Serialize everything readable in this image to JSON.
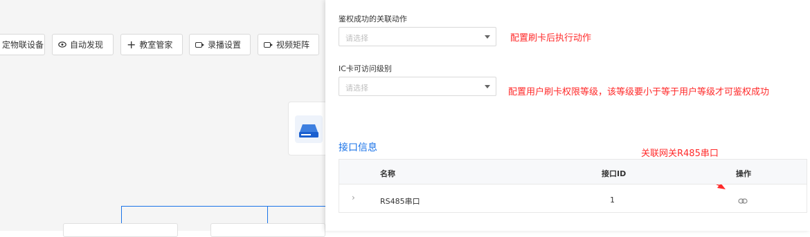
{
  "toolbar": {
    "items": [
      {
        "label": "定物联设备",
        "icon": "none"
      },
      {
        "label": "自动发现",
        "icon": "eye-icon"
      },
      {
        "label": "教室管家",
        "icon": "plus-icon"
      },
      {
        "label": "录播设置",
        "icon": "video-icon"
      },
      {
        "label": "视频矩阵",
        "icon": "video-icon"
      }
    ]
  },
  "drawer": {
    "field1": {
      "label": "鉴权成功的关联动作",
      "placeholder": "请选择"
    },
    "field2": {
      "label": "IC卡可访问级别",
      "placeholder": "请选择"
    },
    "annotations": {
      "note1": "配置刷卡后执行动作",
      "note2": "配置用户刷卡权限等级，该等级要小于等于用户等级才可鉴权成功",
      "note3": "关联网关R485串口"
    },
    "section_title": "接口信息",
    "table": {
      "headers": [
        "名称",
        "接口ID",
        "操作"
      ],
      "rows": [
        {
          "name": "RS485串口",
          "id": "1",
          "action_icon": "link-icon"
        }
      ]
    }
  },
  "colors": {
    "accent": "#1a73e8",
    "annotation": "#ff2a2a"
  }
}
